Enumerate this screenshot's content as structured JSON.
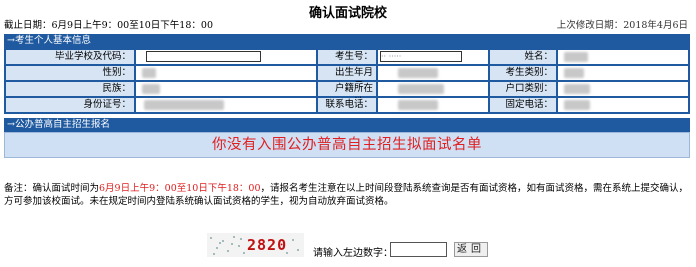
{
  "page_title": "确认面试院校",
  "deadline": "截止日期：6月9日上午9：00至10日下午18：00",
  "last_modified": "上次修改日期：2018年4月6日",
  "sections": {
    "basic_info": "→考生个人基本信息",
    "admission": "→公办普高自主招生报名"
  },
  "fields": {
    "school_label": "毕业学校及代码：",
    "exam_no_label": "考生号：",
    "exam_no_value": "  ·· ·····",
    "name_label": "姓名：",
    "gender_label": "性别：",
    "birth_label": "出生年月日：",
    "category_label": "考生类别：",
    "ethnicity_label": "民族：",
    "hukou_place_label": "户籍所在地：",
    "hukou_label": "户口类别：",
    "id_label": "身份证号：",
    "phone_label": "联系电话：",
    "landline_label": "固定电话："
  },
  "notice": "你没有入围公办普高自主招生拟面试名单",
  "remark": {
    "prefix": "备注：确认面试时间为",
    "time": "6月9日上午9：00至10日下午18：00",
    "suffix": "，请报名考生注意在以上时间段登陆系统查询是否有面试资格，如有面试资格，需在系统上提交确认，方可参加该校面试。未在规定时间内登陆系统确认面试资格的学生，视为自动放弃面试资格。"
  },
  "captcha": {
    "digits": "2820",
    "prompt": "请输入左边数字：",
    "input_value": "",
    "back_label": "返回"
  },
  "colors": {
    "header_bar": "#1f5aa0",
    "label_bg": "#d6e4f4",
    "notice_text": "#e02020"
  }
}
